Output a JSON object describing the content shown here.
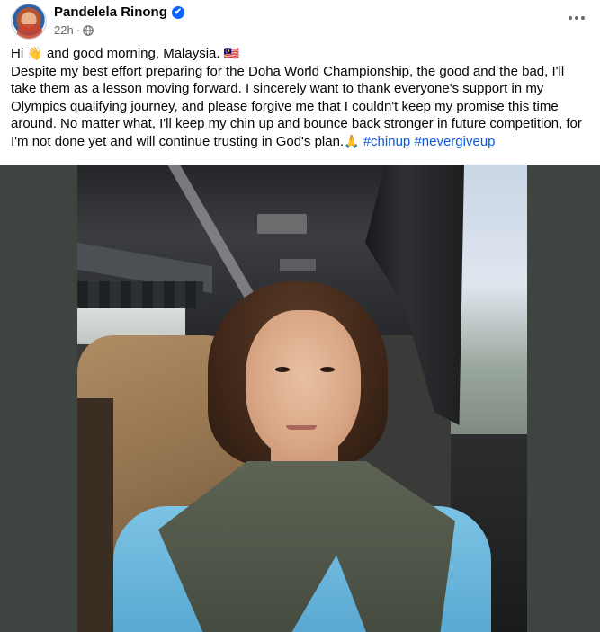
{
  "post": {
    "author": "Pandelela Rinong",
    "verified_badge": "✔",
    "timestamp": "22h",
    "meta_separator": "·",
    "privacy_icon": "globe-icon",
    "more_icon": "more-horizontal-icon",
    "text": {
      "line1_pre": "Hi ",
      "line1_wave": "👋",
      "line1_post": " and good morning, Malaysia. ",
      "line1_flag": "🇲🇾",
      "paragraph": "Despite my best effort preparing for the Doha World Championship, the good and the bad, I'll take them as a lesson moving forward. I sincerely want to thank everyone's support in my Olympics qualifying journey, and please forgive me that I couldn't keep my promise this time around. No matter what, I'll keep my chin up and bounce back stronger in future competition, for I'm not done yet and will continue trusting in God's plan.",
      "pray_emoji": "🙏",
      "hashtags": [
        "#chinup",
        "#nevergiveup"
      ]
    },
    "photo": {
      "subject": "selfie-on-bus"
    }
  },
  "colors": {
    "link_blue": "#0a59d8",
    "verified_blue": "#0866ff",
    "meta_gray": "#65676b",
    "photo_bg": "#3e4440"
  }
}
